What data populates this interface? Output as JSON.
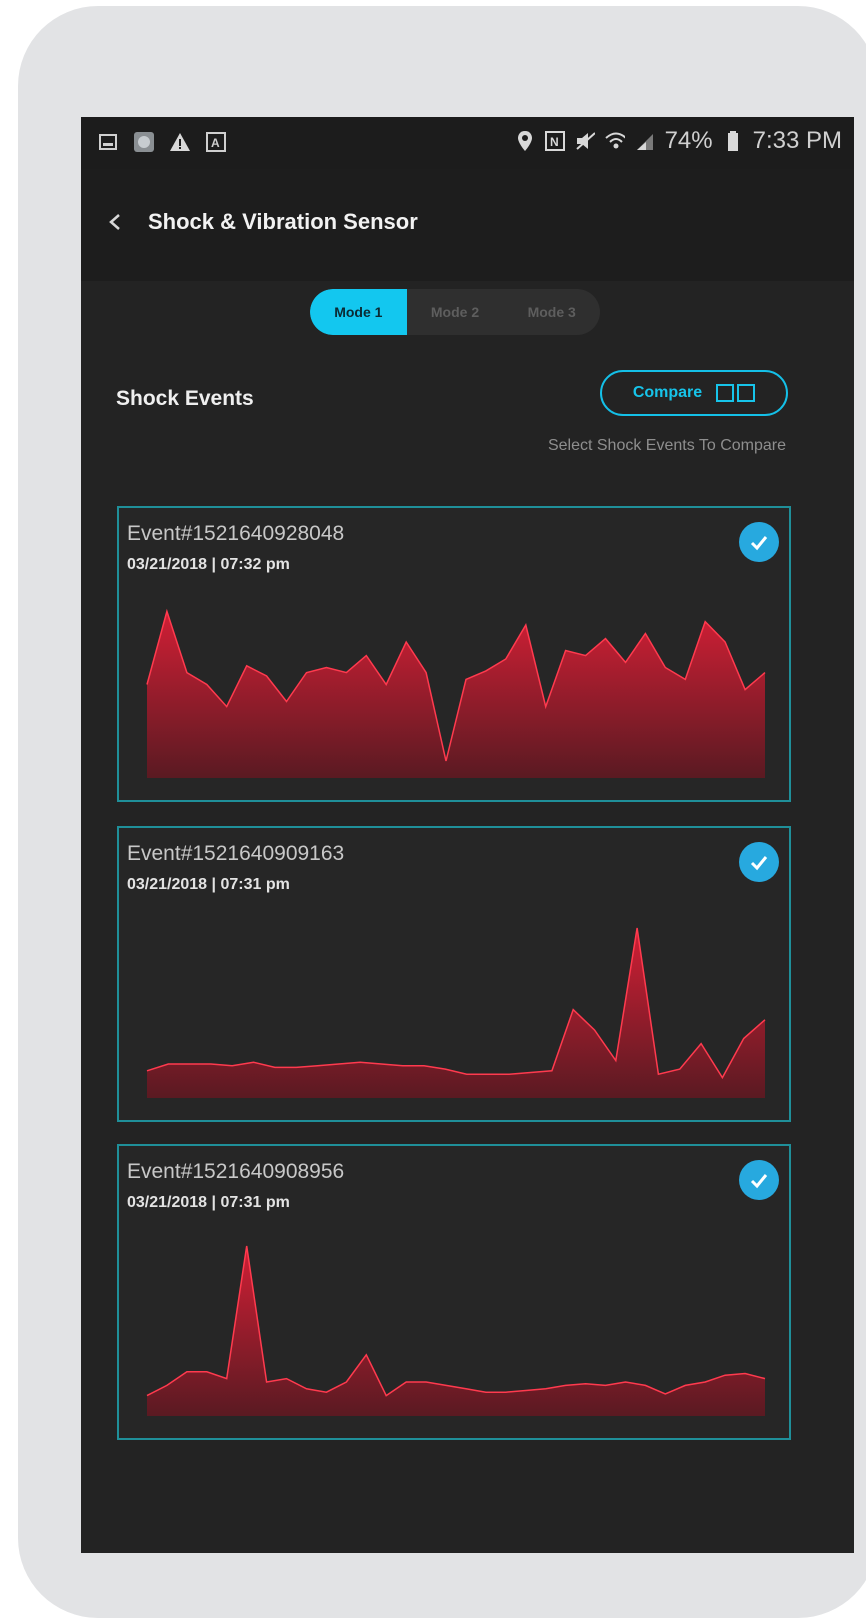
{
  "status_bar": {
    "battery": "74%",
    "time": "7:33 PM",
    "left_icons": [
      "gallery-icon",
      "app-icon",
      "warning-icon",
      "font-icon"
    ],
    "right_icons": [
      "location-icon",
      "nfc-icon",
      "mute-icon",
      "wifi-icon",
      "signal-icon",
      "battery-icon"
    ]
  },
  "app_bar": {
    "title": "Shock & Vibration Sensor"
  },
  "mode_tabs": [
    {
      "label": "Mode 1",
      "active": true
    },
    {
      "label": "Mode 2",
      "active": false
    },
    {
      "label": "Mode 3",
      "active": false
    }
  ],
  "section": {
    "title": "Shock Events",
    "compare_label": "Compare",
    "hint": "Select Shock Events To Compare"
  },
  "colors": {
    "accent": "#13c7ef",
    "card_border": "#1f8f99",
    "chart_fill": "#d11f35",
    "check": "#27a9df"
  },
  "events": [
    {
      "id": "Event#1521640928048",
      "datetime": "03/21/2018 | 07:32 pm",
      "selected": true,
      "values": [
        0.55,
        0.98,
        0.62,
        0.55,
        0.42,
        0.66,
        0.6,
        0.45,
        0.62,
        0.65,
        0.62,
        0.72,
        0.55,
        0.8,
        0.62,
        0.1,
        0.58,
        0.63,
        0.7,
        0.9,
        0.42,
        0.75,
        0.72,
        0.82,
        0.68,
        0.85,
        0.65,
        0.58,
        0.92,
        0.8,
        0.52,
        0.62
      ]
    },
    {
      "id": "Event#1521640909163",
      "datetime": "03/21/2018 | 07:31 pm",
      "selected": true,
      "values": [
        0.16,
        0.2,
        0.2,
        0.2,
        0.19,
        0.21,
        0.18,
        0.18,
        0.19,
        0.2,
        0.21,
        0.2,
        0.19,
        0.19,
        0.17,
        0.14,
        0.14,
        0.14,
        0.15,
        0.16,
        0.52,
        0.4,
        0.22,
        1.0,
        0.14,
        0.17,
        0.32,
        0.12,
        0.35,
        0.46
      ]
    },
    {
      "id": "Event#1521640908956",
      "datetime": "03/21/2018 | 07:31 pm",
      "selected": true,
      "values": [
        0.12,
        0.18,
        0.26,
        0.26,
        0.22,
        1.0,
        0.2,
        0.22,
        0.16,
        0.14,
        0.2,
        0.36,
        0.12,
        0.2,
        0.2,
        0.18,
        0.16,
        0.14,
        0.14,
        0.15,
        0.16,
        0.18,
        0.19,
        0.18,
        0.2,
        0.18,
        0.13,
        0.18,
        0.2,
        0.24,
        0.25,
        0.22
      ]
    }
  ]
}
